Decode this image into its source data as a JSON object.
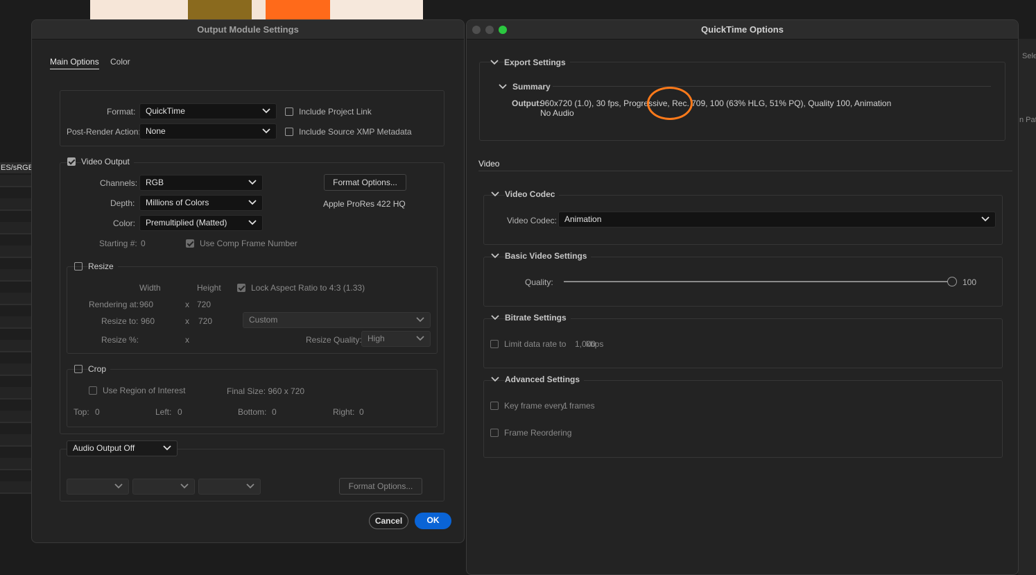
{
  "colors": {
    "accent": "#0a64d6",
    "highlight_ring": "#ff7a1a",
    "traffic_green": "#2bc840"
  },
  "background": {
    "side_label": "ES/sRGB",
    "right_label_1": "Sele",
    "right_label_2": "n Pat"
  },
  "output_module": {
    "title": "Output Module Settings",
    "tabs": [
      "Main Options",
      "Color"
    ],
    "format_label": "Format:",
    "format_value": "QuickTime",
    "include_project_link": "Include Project Link",
    "post_render_label": "Post-Render Action:",
    "post_render_value": "None",
    "include_xmp": "Include Source XMP Metadata",
    "video_output": "Video Output",
    "channels_label": "Channels:",
    "channels_value": "RGB",
    "depth_label": "Depth:",
    "depth_value": "Millions of Colors",
    "color_label": "Color:",
    "color_value": "Premultiplied (Matted)",
    "format_options": "Format Options...",
    "codec_info": "Apple ProRes 422 HQ",
    "starting_label": "Starting #:",
    "starting_value": "0",
    "use_comp_frame": "Use Comp Frame Number",
    "resize": "Resize",
    "width_header": "Width",
    "height_header": "Height",
    "lock_aspect": "Lock Aspect Ratio to 4:3 (1.33)",
    "rendering_at_label": "Rendering at:",
    "rendering_w": "960",
    "rendering_h": "720",
    "resize_to_label": "Resize to:",
    "resize_w": "960",
    "resize_h": "720",
    "x_sep": "x",
    "resize_preset": "Custom",
    "resize_pct_label": "Resize %:",
    "resize_quality_label": "Resize Quality:",
    "resize_quality_value": "High",
    "crop": "Crop",
    "use_roi": "Use Region of Interest",
    "final_size": "Final Size: 960 x 720",
    "top_label": "Top:",
    "top_value": "0",
    "left_label": "Left:",
    "left_value": "0",
    "bottom_label": "Bottom:",
    "bottom_value": "0",
    "right_label": "Right:",
    "right_value": "0",
    "audio_output": "Audio Output Off",
    "audio_format_options": "Format Options...",
    "cancel": "Cancel",
    "ok": "OK"
  },
  "quicktime": {
    "title": "QuickTime Options",
    "export_settings": "Export Settings",
    "summary": "Summary",
    "output_label": "Output:",
    "output_line1": "960x720 (1.0), 30 fps, Progressive, Rec. 709, 100 (63% HLG, 51% PQ), Quality 100, Animation",
    "output_line2": "No Audio",
    "video_tab": "Video",
    "video_codec_section": "Video Codec",
    "video_codec_label": "Video Codec:",
    "video_codec_value": "Animation",
    "basic_video": "Basic Video Settings",
    "quality_label": "Quality:",
    "quality_value": "100",
    "quality_level": 1.0,
    "bitrate_settings": "Bitrate Settings",
    "limit_data_rate": "Limit data rate to",
    "limit_data_value": "1,000",
    "limit_data_unit": "kbps",
    "advanced_settings": "Advanced Settings",
    "key_frame": "Key frame every",
    "key_frame_value": "1",
    "key_frame_unit": "frames",
    "frame_reordering": "Frame Reordering"
  }
}
